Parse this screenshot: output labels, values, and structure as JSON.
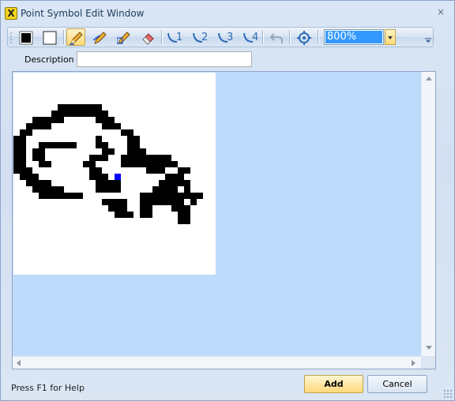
{
  "window": {
    "title": "Point Symbol Edit Window",
    "close_glyph": "×"
  },
  "toolbar": {
    "zoom_value": "800%",
    "tools": [
      {
        "name": "foreground-color-icon",
        "color": "#000000"
      },
      {
        "name": "background-color-icon",
        "color": "#ffffff"
      },
      {
        "name": "pencil-draw-icon"
      },
      {
        "name": "pencil-line-icon"
      },
      {
        "name": "pencil-rectangle-icon"
      },
      {
        "name": "eraser-icon"
      },
      {
        "name": "rotate-1-icon",
        "label": "1"
      },
      {
        "name": "rotate-2-icon",
        "label": "2"
      },
      {
        "name": "rotate-3-icon",
        "label": "3"
      },
      {
        "name": "rotate-4-icon",
        "label": "4"
      },
      {
        "name": "undo-icon"
      },
      {
        "name": "center-target-icon"
      }
    ]
  },
  "form": {
    "description_label": "Description :",
    "description_value": ""
  },
  "status": {
    "help_text": "Press F1 for Help"
  },
  "buttons": {
    "add": "Add",
    "cancel": "Cancel"
  },
  "bitmap": {
    "pixel_color": "#000000",
    "cursor_color": "#0000ff",
    "rows": [
      "................................",
      "................................",
      "................................",
      "................................",
      "................................",
      ".......#######..................",
      "......#########.................",
      "...#####.....###................",
      "..####........###...............",
      ".##..............##.............",
      "##...........#....##............",
      "##..######...##...##............",
      "##.##.........##..###...........",
      "##.##.......###..########.......",
      "##..##.....##....#########......",
      "###.........##.......###..##....",
      ".###........###.........###.....",
      "..####.......####......#####....",
      "...#####.....####.....####.#....",
      "....#######.........##########..",
      "..............####..#######.#...",
      "...............###..##...###....",
      "................###.##....##....",
      "..........................##....",
      "................................",
      "................................",
      "................................",
      "................................",
      "................................",
      "................................",
      "................................",
      "................................"
    ],
    "cursor": {
      "row": 16,
      "col": 16
    }
  }
}
